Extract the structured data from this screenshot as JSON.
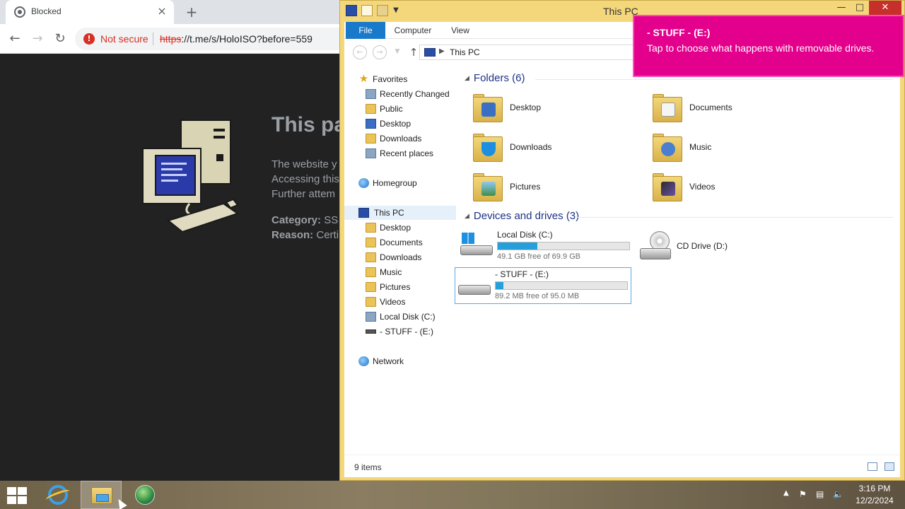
{
  "browser": {
    "tab_title": "Blocked",
    "tab_close": "×",
    "new_tab": "+",
    "security_label": "Not secure",
    "url_scheme": "https",
    "url_rest": "://t.me/s/HoloISO?before=559",
    "page_title": "This pa",
    "page_lines": [
      "The website y",
      "Accessing this",
      "Further attem"
    ],
    "category_label": "Category:",
    "category_value": "SS",
    "reason_label": "Reason:",
    "reason_value": "Certi"
  },
  "explorer": {
    "window_title": "This PC",
    "ribbon_tabs": [
      "File",
      "Computer",
      "View"
    ],
    "address_path": "This PC",
    "nav": {
      "favorites": "Favorites",
      "favorites_items": [
        "Recently Changed",
        "Public",
        "Desktop",
        "Downloads",
        "Recent places"
      ],
      "homegroup": "Homegroup",
      "this_pc": "This PC",
      "this_pc_items": [
        "Desktop",
        "Documents",
        "Downloads",
        "Music",
        "Pictures",
        "Videos",
        "Local Disk (C:)",
        "- STUFF - (E:)"
      ],
      "network": "Network"
    },
    "folders_header": "Folders (6)",
    "folders": [
      "Desktop",
      "Documents",
      "Downloads",
      "Music",
      "Pictures",
      "Videos"
    ],
    "devices_header": "Devices and drives (3)",
    "drives": [
      {
        "label": "Local Disk (C:)",
        "free": "49.1 GB free of 69.9 GB",
        "used_fraction": 0.3
      },
      {
        "label": "CD Drive (D:)"
      },
      {
        "label": "- STUFF - (E:)",
        "free": "89.2 MB free of 95.0 MB",
        "used_fraction": 0.06
      }
    ],
    "status_items": "9 items"
  },
  "toast": {
    "title": "- STUFF - (E:)",
    "body": "Tap to choose what happens with removable drives."
  },
  "taskbar": {
    "time": "3:16 PM",
    "date": "12/2/2024"
  },
  "colors": {
    "toast_bg": "#e3008c",
    "explorer_frame": "#f4d77b",
    "drive_bar": "#26a0da",
    "ribbon_file": "#1979ca",
    "not_secure": "#d93025"
  }
}
